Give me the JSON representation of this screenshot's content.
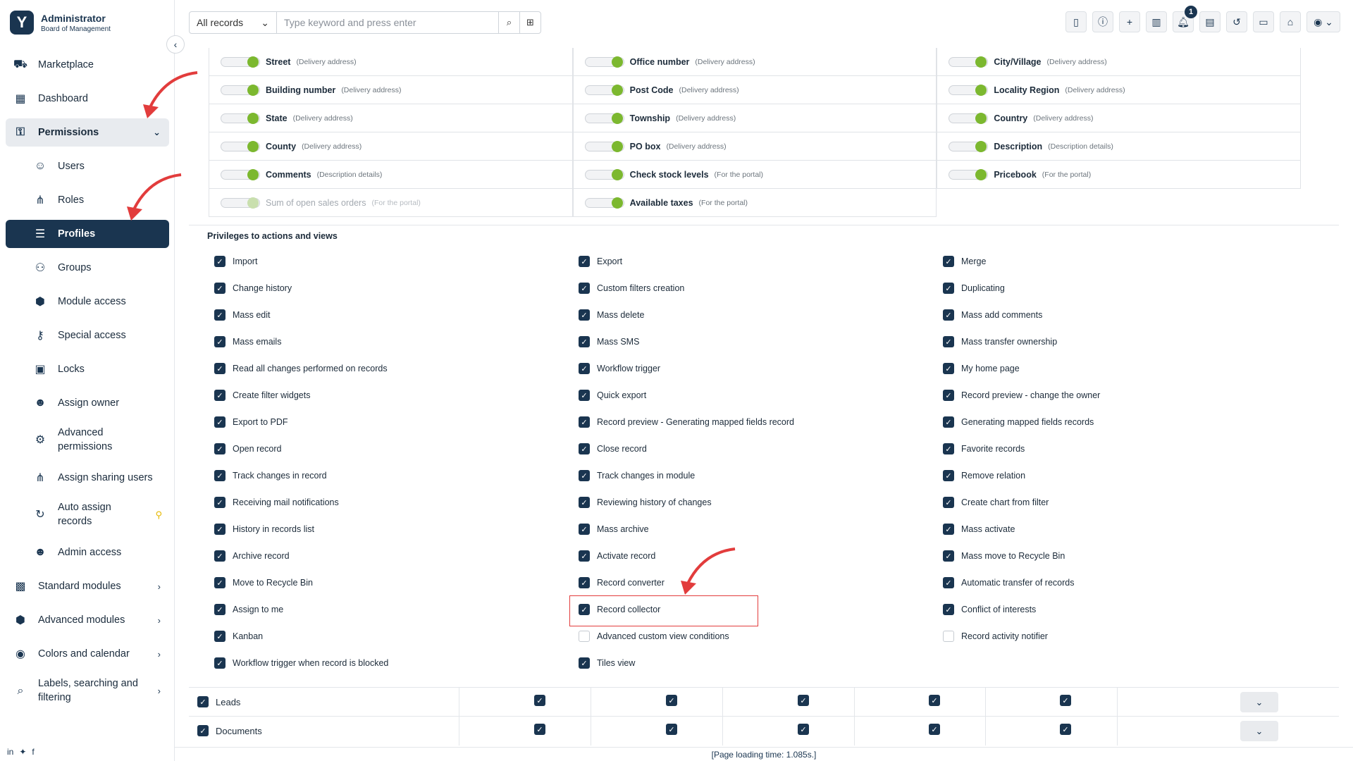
{
  "brand": {
    "title": "Administrator",
    "subtitle": "Board of Management"
  },
  "sidebar": {
    "items": [
      {
        "label": "Marketplace",
        "icon": "marketplace-icon",
        "glyph": "⛟"
      },
      {
        "label": "Dashboard",
        "icon": "dashboard-icon",
        "glyph": "▦"
      },
      {
        "label": "Permissions",
        "icon": "permissions-icon",
        "glyph": "⚿"
      },
      {
        "label": "Users",
        "icon": "users-icon",
        "glyph": "☺"
      },
      {
        "label": "Roles",
        "icon": "roles-icon",
        "glyph": "⋔"
      },
      {
        "label": "Profiles",
        "icon": "profiles-icon",
        "glyph": "☰"
      },
      {
        "label": "Groups",
        "icon": "groups-icon",
        "glyph": "⚇"
      },
      {
        "label": "Module access",
        "icon": "module-access-icon",
        "glyph": "⬢"
      },
      {
        "label": "Special access",
        "icon": "special-access-icon",
        "glyph": "⚷"
      },
      {
        "label": "Locks",
        "icon": "locks-icon",
        "glyph": "▣"
      },
      {
        "label": "Assign owner",
        "icon": "assign-owner-icon",
        "glyph": "☻"
      },
      {
        "label": "Advanced permissions",
        "label1": "Advanced",
        "label2": "permissions",
        "icon": "advanced-permissions-icon",
        "glyph": "⚙"
      },
      {
        "label": "Assign sharing users",
        "icon": "assign-sharing-users-icon",
        "glyph": "⋔"
      },
      {
        "label": "Auto assign records",
        "label1": "Auto assign",
        "label2": "records",
        "icon": "auto-assign-icon",
        "glyph": "↻"
      },
      {
        "label": "Admin access",
        "icon": "admin-access-icon",
        "glyph": "☻"
      },
      {
        "label": "Standard modules",
        "icon": "standard-modules-icon",
        "glyph": "▩"
      },
      {
        "label": "Advanced modules",
        "icon": "advanced-modules-icon",
        "glyph": "⬢"
      },
      {
        "label": "Colors and calendar",
        "icon": "colors-calendar-icon",
        "glyph": "◉"
      },
      {
        "label": "Labels, searching and filtering",
        "label1": "Labels, searching and",
        "label2": "filtering",
        "icon": "labels-search-icon",
        "glyph": "⌕"
      }
    ]
  },
  "search": {
    "scope": "All records",
    "placeholder": "Type keyword and press enter"
  },
  "topbar": {
    "notifications_count": "1"
  },
  "fields": [
    [
      {
        "name": "Street",
        "note": "(Delivery address)"
      },
      {
        "name": "Office number",
        "note": "(Delivery address)"
      },
      {
        "name": "City/Village",
        "note": "(Delivery address)"
      }
    ],
    [
      {
        "name": "Building number",
        "note": "(Delivery address)"
      },
      {
        "name": "Post Code",
        "note": "(Delivery address)"
      },
      {
        "name": "Locality Region",
        "note": "(Delivery address)"
      }
    ],
    [
      {
        "name": "State",
        "note": "(Delivery address)"
      },
      {
        "name": "Township",
        "note": "(Delivery address)"
      },
      {
        "name": "Country",
        "note": "(Delivery address)"
      }
    ],
    [
      {
        "name": "County",
        "note": "(Delivery address)"
      },
      {
        "name": "PO box",
        "note": "(Delivery address)"
      },
      {
        "name": "Description",
        "note": "(Description details)"
      }
    ],
    [
      {
        "name": "Comments",
        "note": "(Description details)"
      },
      {
        "name": "Check stock levels",
        "note": "(For the portal)"
      },
      {
        "name": "Pricebook",
        "note": "(For the portal)"
      }
    ],
    [
      {
        "name": "Sum of open sales orders",
        "note": "(For the portal)"
      },
      {
        "name": "Available taxes",
        "note": "(For the portal)"
      }
    ]
  ],
  "privileges_title": "Privileges to actions and views",
  "privileges": [
    [
      "Import",
      "Export",
      "Merge"
    ],
    [
      "Change history",
      "Custom filters creation",
      "Duplicating"
    ],
    [
      "Mass edit",
      "Mass delete",
      "Mass add comments"
    ],
    [
      "Mass emails",
      "Mass SMS",
      "Mass transfer ownership"
    ],
    [
      "Read all changes performed on records",
      "Workflow trigger",
      "My home page"
    ],
    [
      "Create filter widgets",
      "Quick export",
      "Record preview - change the owner"
    ],
    [
      "Export to PDF",
      "Record preview - Generating mapped fields record",
      "Generating mapped fields records"
    ],
    [
      "Open record",
      "Close record",
      "Favorite records"
    ],
    [
      "Track changes in record",
      "Track changes in module",
      "Remove relation"
    ],
    [
      "Receiving mail notifications",
      "Reviewing history of changes",
      "Create chart from filter"
    ],
    [
      "History in records list",
      "Mass archive",
      "Mass activate"
    ],
    [
      "Archive record",
      "Activate record",
      "Mass move to Recycle Bin"
    ],
    [
      "Move to Recycle Bin",
      "Record converter",
      "Automatic transfer of records"
    ],
    [
      "Assign to me",
      "Record collector",
      "Conflict of interests"
    ],
    [
      "Kanban",
      "Advanced custom view conditions",
      "Record activity notifier"
    ],
    [
      "Workflow trigger when record is blocked",
      "Tiles view"
    ]
  ],
  "unchecked_privileges": [
    "Advanced custom view conditions",
    "Record activity notifier"
  ],
  "modules": [
    {
      "name": "Leads"
    },
    {
      "name": "Documents"
    }
  ],
  "footer": {
    "loading_time": "[Page loading time: 1.085s.]"
  },
  "colors": {
    "brand": "#1a3550",
    "toggle_on": "#7cb82f",
    "highlight": "#e23c3c"
  }
}
